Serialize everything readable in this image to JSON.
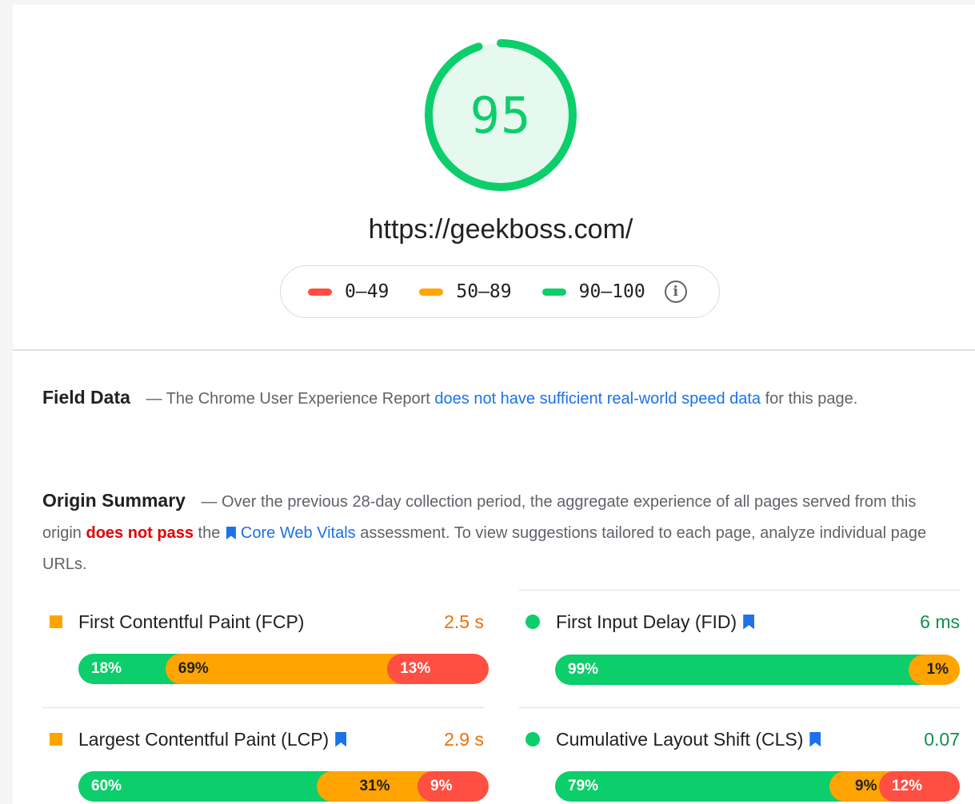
{
  "gauge": {
    "score": "95",
    "color": "#0cce6b",
    "fraction": 0.95
  },
  "url": "https://geekboss.com/",
  "legend": {
    "items": [
      {
        "label": "0–49",
        "color": "#ff4e42"
      },
      {
        "label": "50–89",
        "color": "#ffa400"
      },
      {
        "label": "90–100",
        "color": "#0cce6b"
      }
    ],
    "info_icon": "info-icon"
  },
  "field_data": {
    "heading": "Field Data",
    "text1": "— The Chrome User Experience Report",
    "link": "does not have sufficient real-world speed data",
    "text2": "for this page."
  },
  "origin_summary": {
    "heading": "Origin Summary",
    "text1": "— Over the previous 28-day collection period, the aggregate experience of all pages served from this origin",
    "bad": "does not pass",
    "text2": "the",
    "link": "Core Web Vitals",
    "text3": "assessment. To view suggestions tailored to each page, analyze individual page URLs."
  },
  "metrics": {
    "fcp": {
      "name": "First Contentful Paint (FCP)",
      "value": "2.5 s",
      "value_color": "#e8710a",
      "marker": "square",
      "fast": "18%",
      "avg": "69%",
      "slow": "13%",
      "fast_pct": 18,
      "avg_pct": 69,
      "slow_pct": 13
    },
    "fid": {
      "name": "First Input Delay (FID)",
      "value": "6 ms",
      "value_color": "#0d904f",
      "marker": "circle",
      "fast": "99%",
      "avg": "1%",
      "fast_pct": 99,
      "avg_pct": 1
    },
    "lcp": {
      "name": "Largest Contentful Paint (LCP)",
      "value": "2.9 s",
      "value_color": "#e8710a",
      "marker": "square",
      "fast": "60%",
      "avg": "31%",
      "slow": "9%",
      "fast_pct": 60,
      "avg_pct": 31,
      "slow_pct": 9
    },
    "cls": {
      "name": "Cumulative Layout Shift (CLS)",
      "value": "0.07",
      "value_color": "#0d904f",
      "marker": "circle",
      "fast": "79%",
      "avg": "9%",
      "slow": "12%",
      "fast_pct": 79,
      "avg_pct": 9,
      "slow_pct": 12
    }
  }
}
